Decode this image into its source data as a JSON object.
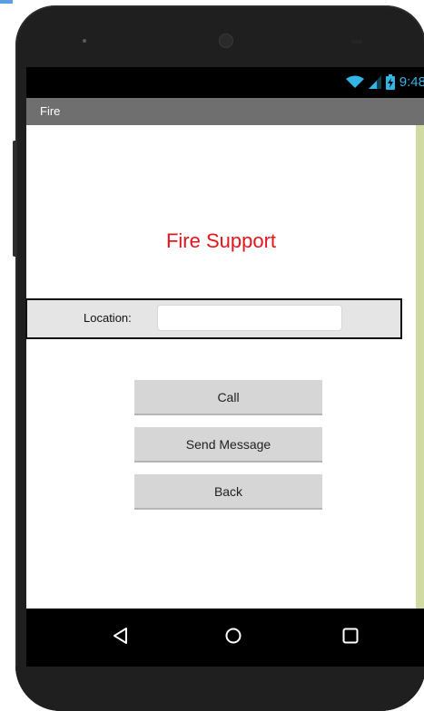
{
  "status_bar": {
    "time": "9:48",
    "icons": [
      "wifi-icon",
      "signal-icon",
      "battery-icon"
    ],
    "accent_color": "#33b5e5"
  },
  "app_bar": {
    "title": "Fire"
  },
  "main": {
    "heading": "Fire Support",
    "heading_color": "#e8141b",
    "location": {
      "label": "Location:",
      "value": "",
      "placeholder": ""
    },
    "buttons": {
      "call": "Call",
      "send_message": "Send Message",
      "back": "Back"
    }
  },
  "nav_bar": {
    "icons": [
      "back-triangle-icon",
      "home-circle-icon",
      "recents-square-icon"
    ]
  }
}
